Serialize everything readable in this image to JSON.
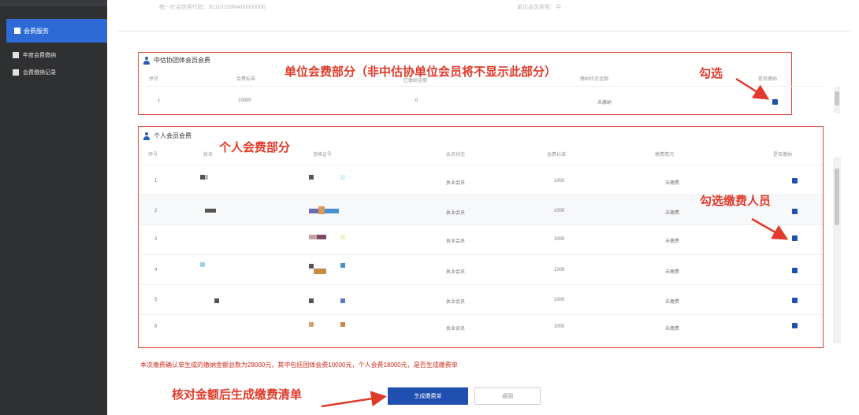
{
  "sidebar": {
    "active": "会费服务",
    "items": [
      {
        "label": "年度会费缴纳"
      },
      {
        "label": "会费缴纳记录"
      }
    ]
  },
  "top": {
    "left_text": "统一社会信用代码：91110108MA00000000",
    "right_text": "单位会员类型：中"
  },
  "group": {
    "title": "中估协团体会员会费",
    "headers": [
      "序号",
      "会费标准",
      "已缴纳金额",
      "缴纳状态金额",
      "是否缴纳"
    ],
    "row": {
      "index": "1",
      "standard": "10000",
      "paid": "0",
      "status": "未缴纳"
    }
  },
  "individual": {
    "title": "个人会员会费",
    "headers": [
      "序号",
      "姓名",
      "资格证号",
      "会员状态",
      "会费标准",
      "缴费情况",
      "是否缴纳"
    ],
    "rows": [
      {
        "index": "1",
        "status": "执业会员",
        "fee": "1000",
        "paid": "未缴费"
      },
      {
        "index": "2",
        "status": "执业会员",
        "fee": "1000",
        "paid": "未缴费"
      },
      {
        "index": "3",
        "status": "执业会员",
        "fee": "1000",
        "paid": "未缴费"
      },
      {
        "index": "4",
        "status": "执业会员",
        "fee": "1000",
        "paid": "未缴费"
      },
      {
        "index": "5",
        "status": "执业会员",
        "fee": "1000",
        "paid": "未缴费"
      },
      {
        "index": "6",
        "status": "执业会员",
        "fee": "1000",
        "paid": "未缴费"
      }
    ]
  },
  "annotations": {
    "unit_fee": "单位会费部分（非中估协单位会员将不显示此部分）",
    "check": "勾选",
    "personal_fee": "个人会费部分",
    "check_payers": "勾选缴费人员",
    "generate": "核对金额后生成缴费清单"
  },
  "summary": "本次缴费确认单生成的缴纳金额总数为28000元，其中包括团体会费10000元，个人会费18000元，是否生成缴费单",
  "buttons": {
    "generate": "生成缴费单",
    "back": "返回"
  },
  "colors": {
    "sidebar": "#2f3032",
    "active": "#2d6ad6",
    "annotation": "#e03a2a",
    "primary": "#1f4fb0"
  }
}
